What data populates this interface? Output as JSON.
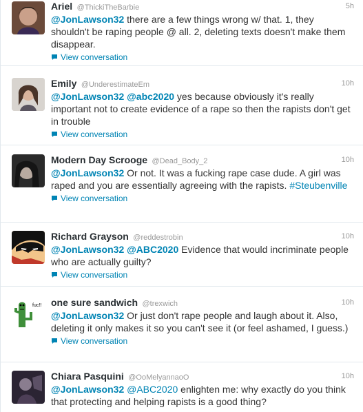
{
  "tweets": [
    {
      "fullname": "Ariel",
      "username": "@ThickiTheBarbie",
      "time": "5h",
      "mention1": "@JonLawson32",
      "text": " there are a few things wrong w/ that. 1, they shouldn't be raping people @ all. 2, deleting texts doesn't make them disappear.",
      "view": "View conversation",
      "avatar_icon": "profile-photo"
    },
    {
      "fullname": "Emily",
      "username": "@UnderestimateEm",
      "time": "10h",
      "mention1": "@JonLawson32",
      "mention2": "@abc2020",
      "text": " yes because obviously it's really important not to create evidence of a rape so then the rapists don't get in trouble",
      "view": "View conversation",
      "avatar_icon": "profile-photo"
    },
    {
      "fullname": "Modern Day Scrooge",
      "username": "@Dead_Body_2",
      "time": "10h",
      "mention1": "@JonLawson32",
      "text": " Or not. It was a fucking rape case dude. A girl was raped and you are essentially agreeing with the rapists. ",
      "hashtag": "#Steubenville",
      "view": "View conversation",
      "avatar_icon": "profile-photo"
    },
    {
      "fullname": "Richard Grayson",
      "username": "@reddestrobin",
      "time": "10h",
      "mention1": "@JonLawson32",
      "mention2": "@ABC2020",
      "text": " Evidence that would incriminate people who are actually guilty?",
      "view": "View conversation",
      "avatar_icon": "cartoon-robin"
    },
    {
      "fullname": "one sure sandwich",
      "username": "@trexwich",
      "time": "10h",
      "mention1": "@JonLawson32",
      "text": " Or just don't rape people and laugh about it. Also, deleting it only makes it so you can't see it (or feel ashamed, I guess.)",
      "view": "View conversation",
      "avatar_icon": "cartoon-cactus"
    },
    {
      "fullname": "Chiara Pasquini",
      "username": "@OoMelyannaoO",
      "time": "10h",
      "mention1": "@JonLawson32",
      "mention2": "@ABC2020",
      "text": " enlighten me: why exactly do you think that protecting and helping rapists is a good thing?",
      "avatar_icon": "profile-photo"
    }
  ],
  "colors": {
    "link": "#0084b4",
    "name": "#292f33",
    "meta": "#999999",
    "divider": "#e1e8ed"
  }
}
